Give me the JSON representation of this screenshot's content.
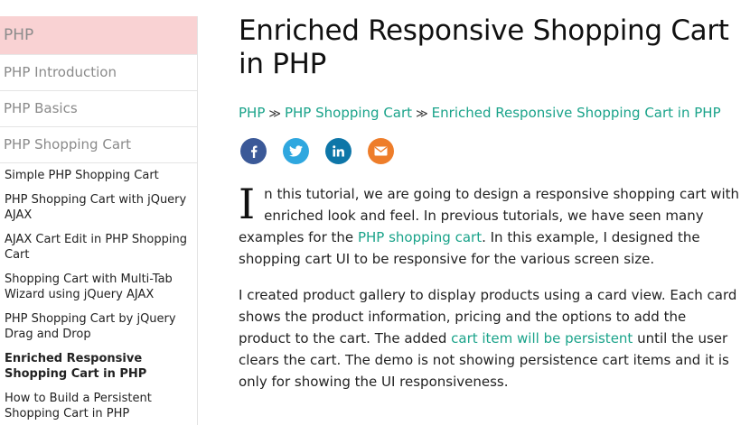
{
  "sidebar": {
    "header": "PHP",
    "categories": [
      "PHP Introduction",
      "PHP Basics",
      "PHP Shopping Cart"
    ],
    "links": [
      "Simple PHP Shopping Cart",
      "PHP Shopping Cart with jQuery AJAX",
      "AJAX Cart Edit in PHP Shopping Cart",
      "Shopping Cart with Multi-Tab Wizard using jQuery AJAX",
      "PHP Shopping Cart by jQuery Drag and Drop",
      "Enriched Responsive Shopping Cart in PHP",
      "How to Build a Persistent Shopping Cart in PHP"
    ],
    "active_index": 5
  },
  "main": {
    "title": "Enriched Responsive Shopping Cart in PHP",
    "breadcrumb": {
      "items": [
        "PHP",
        "PHP Shopping Cart",
        "Enriched Responsive Shopping Cart in PHP"
      ],
      "separator": "≫"
    },
    "social": [
      {
        "name": "facebook",
        "color": "#3b5998"
      },
      {
        "name": "twitter",
        "color": "#2fa7df"
      },
      {
        "name": "linkedin",
        "color": "#0e76a8"
      },
      {
        "name": "email",
        "color": "#ee7d2a"
      }
    ],
    "paragraph1": {
      "dropcap": "I",
      "text_before": "n this tutorial, we are going to design a responsive shopping cart with enriched look and feel. In previous tutorials, we have seen many examples for the ",
      "link": "PHP shopping cart",
      "text_after": ". In this example, I designed the shopping cart UI to be responsive for the various screen size."
    },
    "paragraph2": {
      "text_before": "I created product gallery to display products using a card view. Each card shows the product information, pricing and the options to add the product to the cart. The added ",
      "link": "cart item will be persistent",
      "text_after": " until the user clears the cart. The demo is not showing persistence cart items and it is only for showing the UI responsiveness."
    }
  },
  "colors": {
    "link": "#1aa38a",
    "sidebar_header_bg": "#f9d2d3"
  }
}
